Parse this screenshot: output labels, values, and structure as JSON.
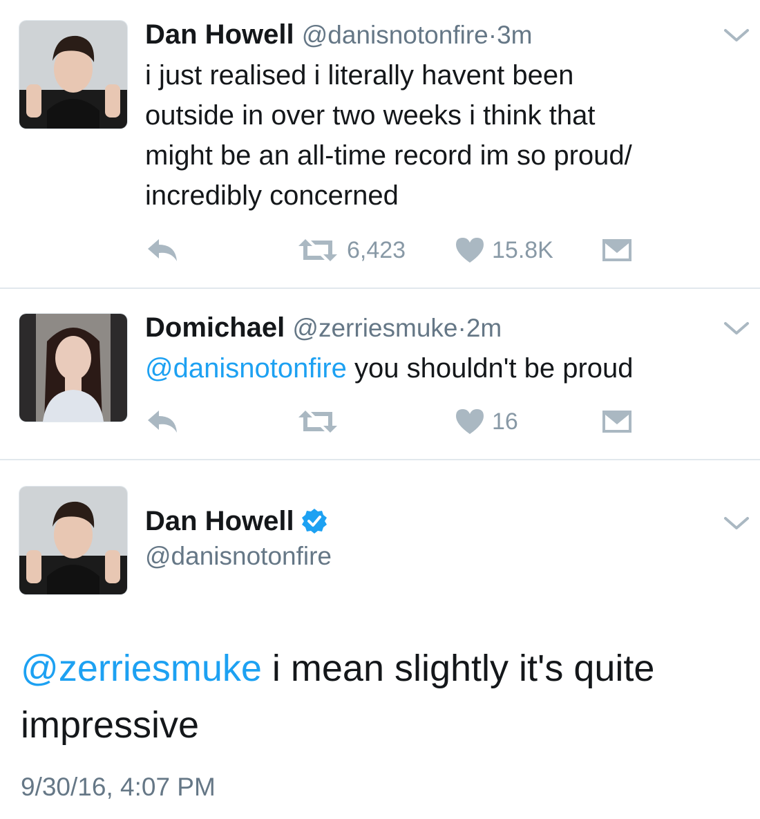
{
  "tweets": [
    {
      "name": "Dan Howell",
      "handle": "@danisnotonfire",
      "dot": "·",
      "time": "3m",
      "lines": [
        "i just realised i literally havent been",
        "outside in over two weeks i think that",
        "might be an all-time record im so proud/",
        "incredibly concerned"
      ],
      "retweets": "6,423",
      "likes": "15.8K",
      "icons": [
        "reply-icon",
        "retweet-icon",
        "heart-icon",
        "message-icon"
      ]
    },
    {
      "name": "Domichael",
      "handle": "@zerriesmuke",
      "dot": "·",
      "time": "2m",
      "mention": "@danisnotonfire",
      "text": " you shouldn't be proud",
      "retweets": "",
      "likes": "16",
      "icons": [
        "reply-icon",
        "retweet-icon",
        "heart-icon",
        "message-icon"
      ]
    },
    {
      "name": "Dan Howell",
      "handle": "@danisnotonfire",
      "verified_icon": "verified-badge-icon",
      "mention": "@zerriesmuke",
      "text_line1": " i mean slightly it's quite",
      "text_line2": "impressive",
      "timestamp": "9/30/16, 4:07 PM"
    }
  ],
  "colors": {
    "link": "#1da1f2",
    "secondary_text": "#657786",
    "action_icon": "#aab8c2",
    "divider": "#e1e8ed"
  }
}
